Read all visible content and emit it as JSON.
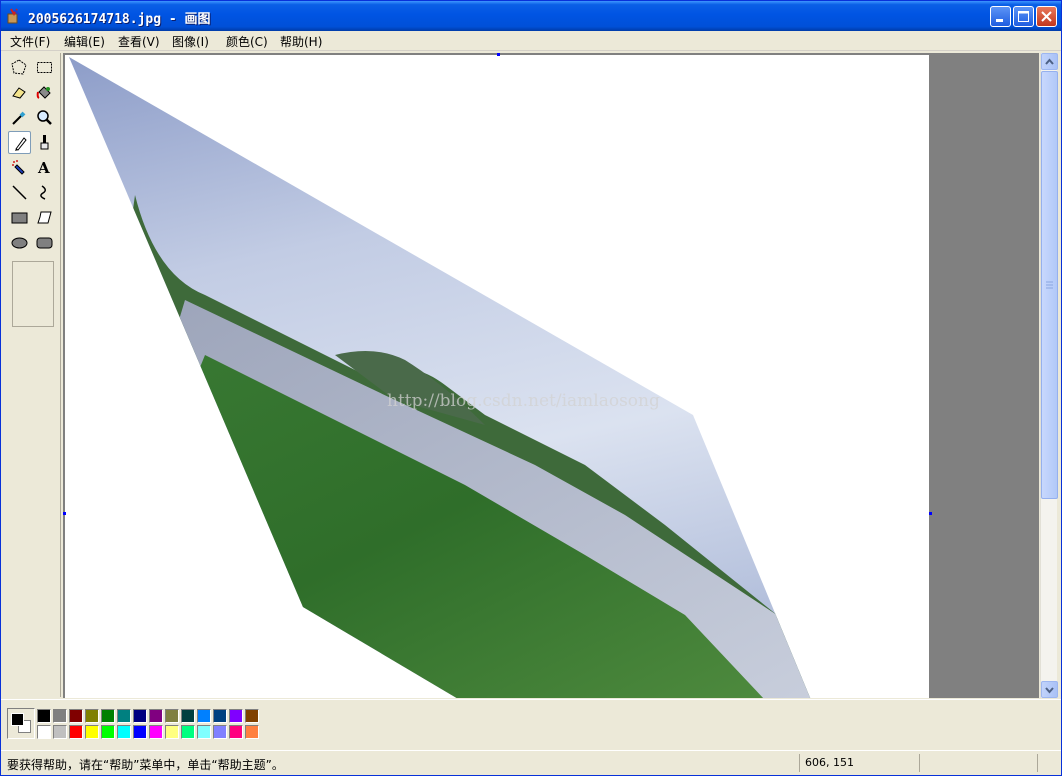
{
  "window": {
    "title": "2005626174718.jpg - 画图"
  },
  "menu": [
    {
      "id": "file",
      "label": "文件(F)"
    },
    {
      "id": "edit",
      "label": "编辑(E)"
    },
    {
      "id": "view",
      "label": "查看(V)"
    },
    {
      "id": "image",
      "label": "图像(I)"
    },
    {
      "id": "colors",
      "label": "颜色(C)"
    },
    {
      "id": "help",
      "label": "帮助(H)"
    }
  ],
  "tools": [
    {
      "name": "free-select",
      "icon": "free-form-select-icon"
    },
    {
      "name": "rect-select",
      "icon": "rect-select-icon"
    },
    {
      "name": "eraser",
      "icon": "eraser-icon"
    },
    {
      "name": "fill",
      "icon": "fill-bucket-icon"
    },
    {
      "name": "pick-color",
      "icon": "color-picker-icon"
    },
    {
      "name": "magnifier",
      "icon": "magnifier-icon"
    },
    {
      "name": "pencil",
      "icon": "pencil-icon",
      "selected": true
    },
    {
      "name": "brush",
      "icon": "brush-icon"
    },
    {
      "name": "airbrush",
      "icon": "airbrush-icon"
    },
    {
      "name": "text",
      "icon": "text-icon"
    },
    {
      "name": "line",
      "icon": "line-icon"
    },
    {
      "name": "curve",
      "icon": "curve-icon"
    },
    {
      "name": "rectangle",
      "icon": "rectangle-icon"
    },
    {
      "name": "polygon",
      "icon": "polygon-icon"
    },
    {
      "name": "ellipse",
      "icon": "ellipse-icon"
    },
    {
      "name": "rounded-rect",
      "icon": "rounded-rect-icon"
    }
  ],
  "canvas": {
    "watermark": "http://blog.csdn.net/iamlaosong"
  },
  "palette": {
    "foreground": "#000000",
    "background": "#ffffff",
    "row1": [
      "#000000",
      "#808080",
      "#800000",
      "#808000",
      "#008000",
      "#008080",
      "#000080",
      "#800080",
      "#808040",
      "#004040",
      "#0080ff",
      "#004080",
      "#8000ff",
      "#804000"
    ],
    "row2": [
      "#ffffff",
      "#c0c0c0",
      "#ff0000",
      "#ffff00",
      "#00ff00",
      "#00ffff",
      "#0000ff",
      "#ff00ff",
      "#ffff80",
      "#00ff80",
      "#80ffff",
      "#8080ff",
      "#ff0080",
      "#ff8040"
    ]
  },
  "status": {
    "help_text": "要获得帮助，请在“帮助”菜单中，单击“帮助主题”。",
    "coords": "606, 151"
  }
}
